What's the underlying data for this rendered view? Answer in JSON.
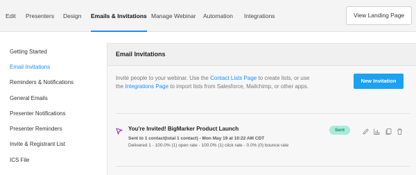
{
  "nav": {
    "tabs": [
      {
        "label": "Edit"
      },
      {
        "label": "Presenters"
      },
      {
        "label": "Design"
      },
      {
        "label": "Emails & Invitations"
      },
      {
        "label": "Manage Webinar"
      },
      {
        "label": "Automation"
      },
      {
        "label": "Integrations"
      }
    ],
    "active_tab": "Emails & Invitations",
    "landing_button": "View Landing Page"
  },
  "sidebar": {
    "items": [
      {
        "label": "Getting Started"
      },
      {
        "label": "Email Invitations"
      },
      {
        "label": "Reminders & Notifications"
      },
      {
        "label": "General Emails"
      },
      {
        "label": "Presenter Notifications"
      },
      {
        "label": "Presenter Reminders"
      },
      {
        "label": "Invite & Registrant List"
      },
      {
        "label": "ICS File"
      }
    ],
    "active_item": "Email Invitations"
  },
  "main": {
    "title": "Email Invitations",
    "intro": {
      "part1": "Invite people to your webinar. Use the ",
      "link1": "Contact Lists Page",
      "part2": " to create lists, or use the ",
      "link2": "Integrations Page",
      "part3": " to import lists from Salesforce, Mailchimp, or other apps."
    },
    "new_button": "New Invitation",
    "invitation": {
      "title": "You're Invited! BigMarker Product Launch",
      "sent_line": "Sent to 1 contact(total 1 contact) - Mon May 19 at 10:22 AM CDT",
      "stats_line": "Delivered 1 - 100.0% (1) open rate - 100.0% (1) click rate - 0.0% (0) bounce rate",
      "status": "Sent",
      "icons": [
        "send-icon",
        "pencil-icon",
        "bar-chart-icon",
        "copy-icon",
        "trash-icon"
      ]
    }
  },
  "colors": {
    "accent": "#1a8cff",
    "button": "#1da1f2",
    "badge_bg": "#a7ecd9",
    "badge_text": "#1b8a6b",
    "send_icon": "#9b2bd6"
  }
}
